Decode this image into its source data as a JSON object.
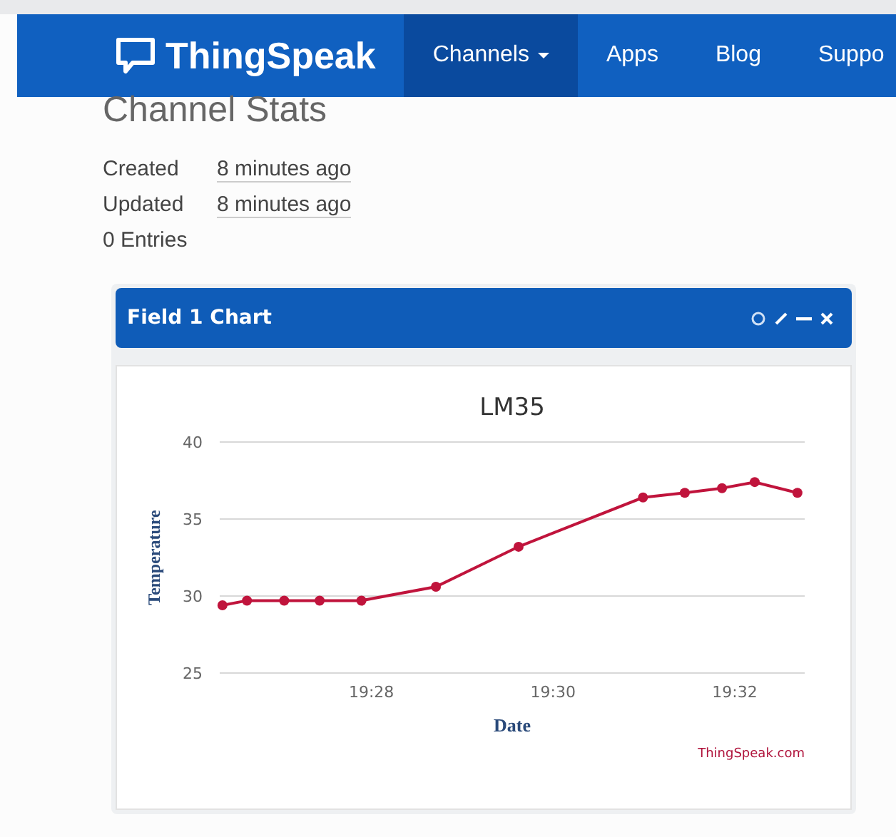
{
  "nav": {
    "brand": "ThingSpeak",
    "items": [
      {
        "label": "Channels",
        "selected": true,
        "dropdown": true
      },
      {
        "label": "Apps",
        "selected": false,
        "dropdown": false
      },
      {
        "label": "Blog",
        "selected": false,
        "dropdown": false
      },
      {
        "label": "Suppo",
        "selected": false,
        "dropdown": false
      }
    ]
  },
  "page": {
    "title": "Channel Stats",
    "stats": [
      {
        "label": "Created",
        "value": "8 minutes ago"
      },
      {
        "label": "Updated",
        "value": "8 minutes ago"
      },
      {
        "label": "0 Entries"
      }
    ]
  },
  "panel": {
    "title": "Field 1 Chart",
    "chart_data": {
      "type": "line",
      "title": "LM35",
      "xlabel": "Date",
      "ylabel": "Temperature",
      "ylim": [
        25,
        40
      ],
      "yticks": [
        25,
        30,
        35,
        40
      ],
      "xlim": [
        1166.33,
        1172.77
      ],
      "xticks": [
        {
          "value": 1168,
          "label": "19:28"
        },
        {
          "value": 1170,
          "label": "19:30"
        },
        {
          "value": 1172,
          "label": "19:32"
        }
      ],
      "x": [
        1166.36,
        1166.63,
        1167.04,
        1167.43,
        1167.89,
        1168.71,
        1169.62,
        1170.99,
        1171.45,
        1171.86,
        1172.22,
        1172.69
      ],
      "series": [
        {
          "color": "#c0143c",
          "marker": "circle",
          "values": [
            29.4,
            29.7,
            29.7,
            29.7,
            29.7,
            30.6,
            33.2,
            36.4,
            36.7,
            37.0,
            37.4,
            36.7
          ]
        }
      ],
      "annotations": [
        {
          "text": "ThingSpeak.com"
        }
      ]
    }
  }
}
